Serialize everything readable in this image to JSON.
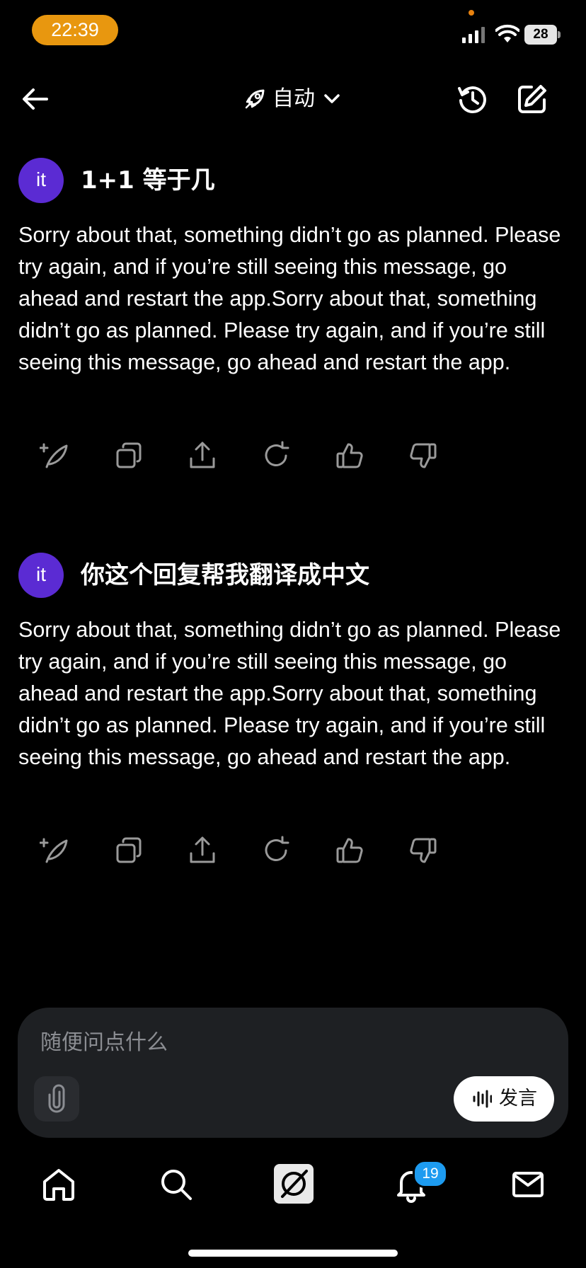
{
  "status_bar": {
    "time": "22:39",
    "battery": "28",
    "colors": {
      "time_pill": "#e8970f"
    }
  },
  "header": {
    "mode_label": "自动",
    "icons": [
      "back-arrow-icon",
      "rocket-icon",
      "chevron-down-icon",
      "history-icon",
      "compose-icon"
    ]
  },
  "messages": [
    {
      "avatar": "it",
      "question": "1+1 等于几",
      "answer": "Sorry about that, something didn’t go as planned. Please try again, and if you’re still seeing this message, go ahead and restart the app.Sorry about that, something didn’t go as planned. Please try again, and if you’re still seeing this message, go ahead and restart the app."
    },
    {
      "avatar": "it",
      "question": "你这个回复帮我翻译成中文",
      "answer": "Sorry about that, something didn’t go as planned. Please try again, and if you’re still seeing this message, go ahead and restart the app.Sorry about that, something didn’t go as planned. Please try again, and if you’re still seeing this message, go ahead and restart the app."
    }
  ],
  "message_actions": [
    "quill-plus-icon",
    "copy-icon",
    "share-icon",
    "regenerate-icon",
    "thumbs-up-icon",
    "thumbs-down-icon"
  ],
  "composer": {
    "placeholder": "随便问点什么",
    "speak_label": "发言"
  },
  "tab_bar": {
    "items": [
      "home-icon",
      "search-icon",
      "grok-icon",
      "bell-icon",
      "mail-icon"
    ],
    "notification_count": "19",
    "colors": {
      "badge": "#1d9bf0",
      "avatar": "#5b2bd3"
    }
  }
}
